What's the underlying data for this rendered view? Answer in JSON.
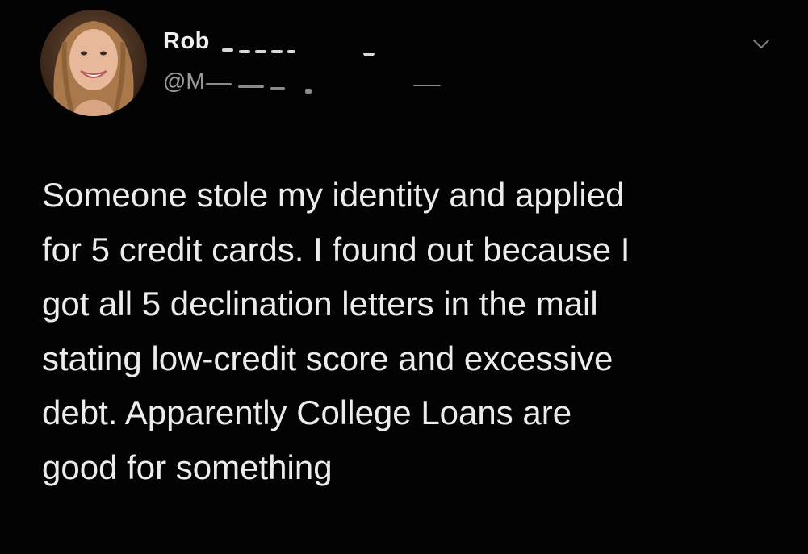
{
  "tweet": {
    "display_name": "Rob",
    "handle": "@M",
    "text": "Someone stole my identity and  applied\nfor 5 credit cards. I found out because I\ngot all 5 declination letters in the mail\nstating low-credit score and excessive\ndebt. Apparently College Loans are\ngood for something"
  },
  "icons": {
    "avatar": "avatar-photo",
    "menu": "chevron-down-icon"
  },
  "colors": {
    "background": "#030303",
    "text": "#ececec",
    "muted": "#9a9a9a"
  }
}
